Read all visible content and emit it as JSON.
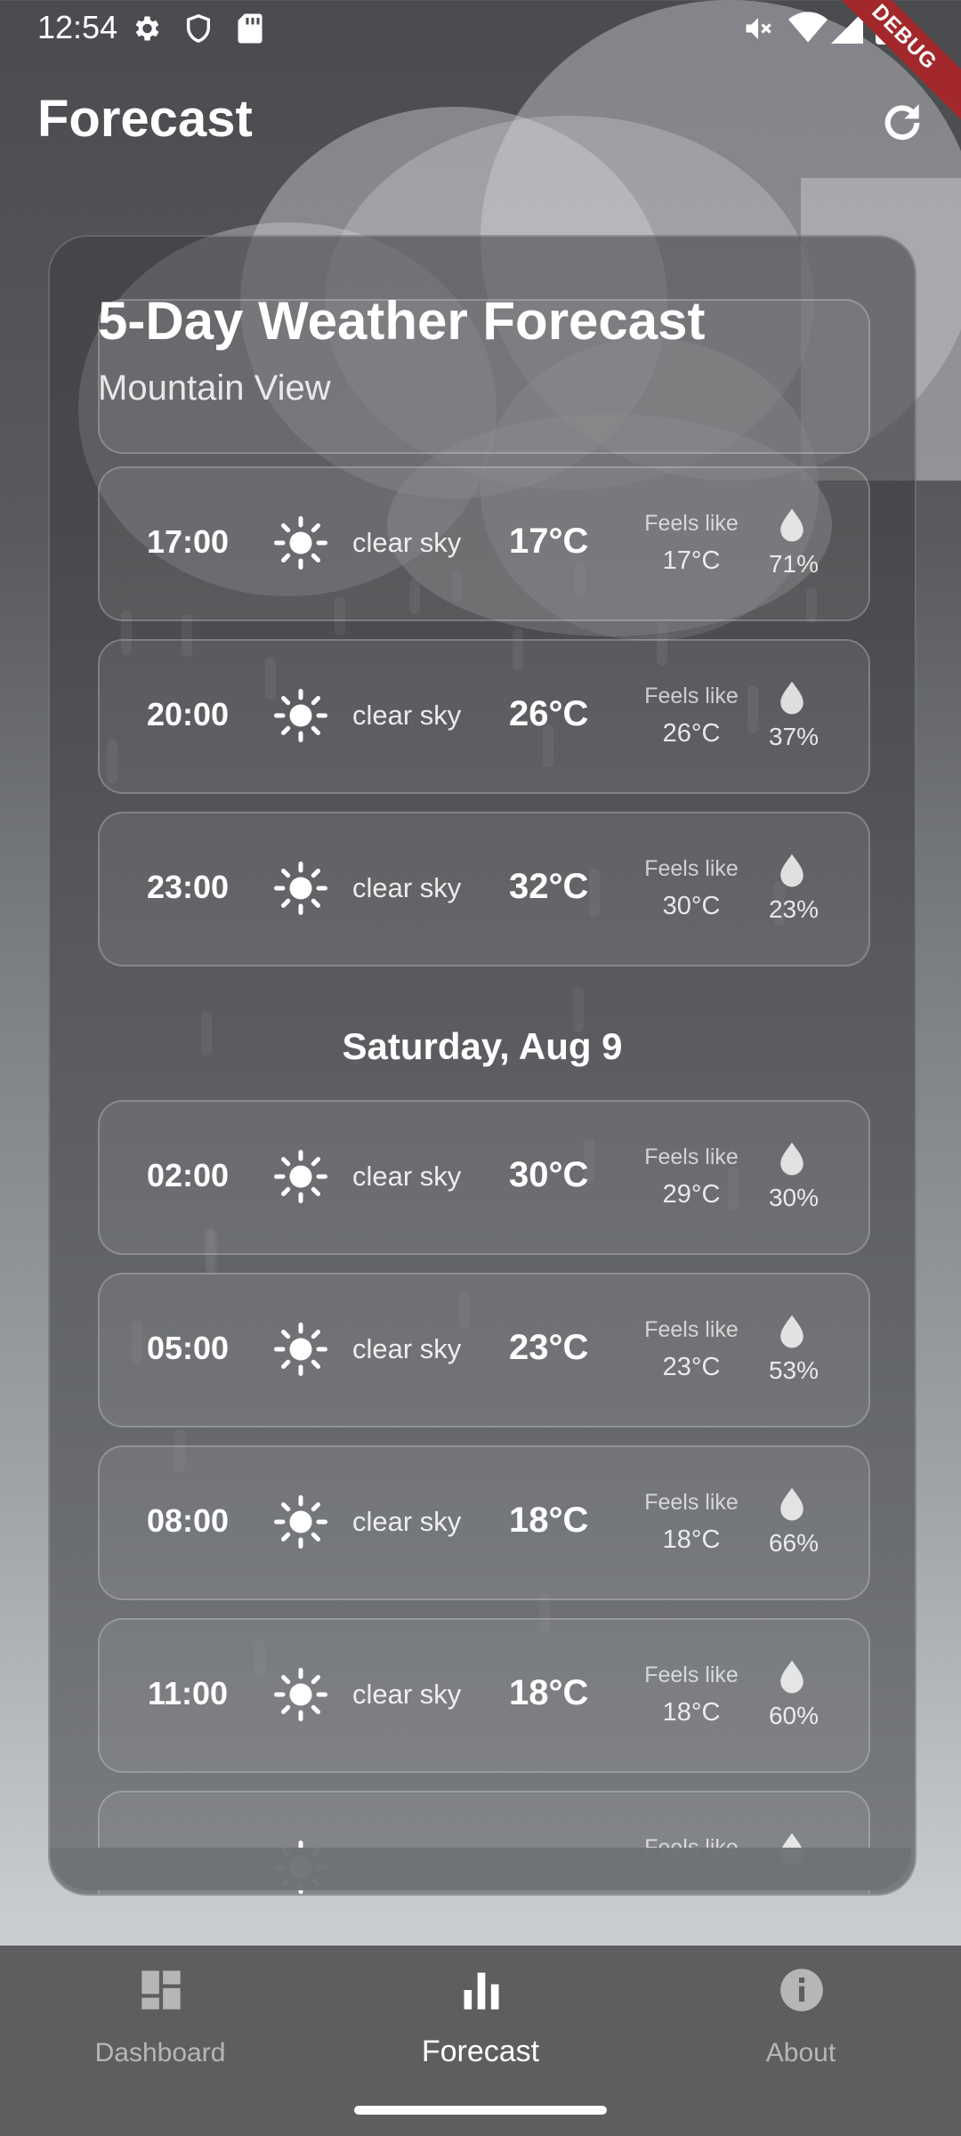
{
  "status_bar": {
    "time": "12:54",
    "debug_label": "DEBUG"
  },
  "appbar": {
    "title": "Forecast"
  },
  "card": {
    "title": "5-Day Weather Forecast",
    "location": "Mountain View"
  },
  "feels_like_label": "Feels like",
  "day_header": "Saturday, Aug 9",
  "forecasts_day1": [
    {
      "time": "17:00",
      "description": "clear sky",
      "temp": "17°C",
      "feels": "17°C",
      "humidity": "71%"
    },
    {
      "time": "20:00",
      "description": "clear sky",
      "temp": "26°C",
      "feels": "26°C",
      "humidity": "37%"
    },
    {
      "time": "23:00",
      "description": "clear sky",
      "temp": "32°C",
      "feels": "30°C",
      "humidity": "23%"
    }
  ],
  "forecasts_day2": [
    {
      "time": "02:00",
      "description": "clear sky",
      "temp": "30°C",
      "feels": "29°C",
      "humidity": "30%"
    },
    {
      "time": "05:00",
      "description": "clear sky",
      "temp": "23°C",
      "feels": "23°C",
      "humidity": "53%"
    },
    {
      "time": "08:00",
      "description": "clear sky",
      "temp": "18°C",
      "feels": "18°C",
      "humidity": "66%"
    },
    {
      "time": "11:00",
      "description": "clear sky",
      "temp": "18°C",
      "feels": "18°C",
      "humidity": "60%"
    }
  ],
  "nav": [
    {
      "label": "Dashboard",
      "icon": "dashboard-icon"
    },
    {
      "label": "Forecast",
      "icon": "bar-chart-icon"
    },
    {
      "label": "About",
      "icon": "info-icon"
    }
  ]
}
